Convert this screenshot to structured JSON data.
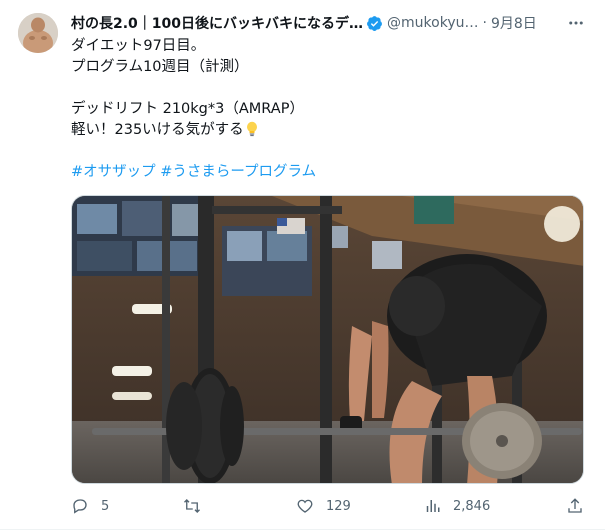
{
  "author": {
    "display_name": "村の長2.0｜100日後にバッキバキになるデ…",
    "handle": "@mukokyu…",
    "date": "9月8日",
    "verified_color": "#1d9bf0"
  },
  "post": {
    "lines": [
      "ダイエット97日目。",
      "プログラム10週目（計測）",
      "",
      "デッドリフト 210kg*3（AMRAP）",
      "軽い！235いける気がする"
    ],
    "emoji": "light-bulb-icon",
    "hashtags": [
      "#オサザップ",
      "#うさまらープログラム"
    ]
  },
  "media": {
    "description_icon": "gym-deadlift-photo"
  },
  "actions": {
    "replies": "5",
    "retweets": "",
    "likes": "129",
    "views": "2,846"
  },
  "colors": {
    "link": "#1d9bf0",
    "secondary_text": "#536471",
    "primary_text": "#0f1419"
  }
}
